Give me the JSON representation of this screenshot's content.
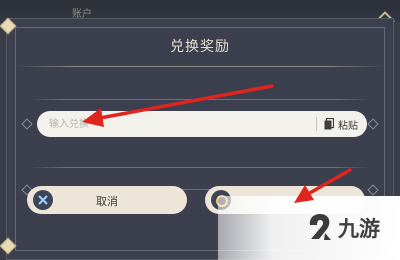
{
  "background": {
    "account_label": "账户"
  },
  "dialog": {
    "title": "兑换奖励",
    "input": {
      "placeholder": "输入兑换"
    },
    "paste_label": "粘贴",
    "cancel_label": "取消"
  },
  "watermark": {
    "brand_text": "九游"
  },
  "colors": {
    "dialog_bg": "#3b3f4e",
    "input_bg": "#f3f1ec",
    "button_bg": "#ece5d8",
    "arrow_red": "#e0241e",
    "accent_gold": "#f0c64a"
  },
  "icons": [
    "paste-icon",
    "cancel-x-icon",
    "confirm-circle-icon",
    "jiuyou-logo-icon"
  ]
}
